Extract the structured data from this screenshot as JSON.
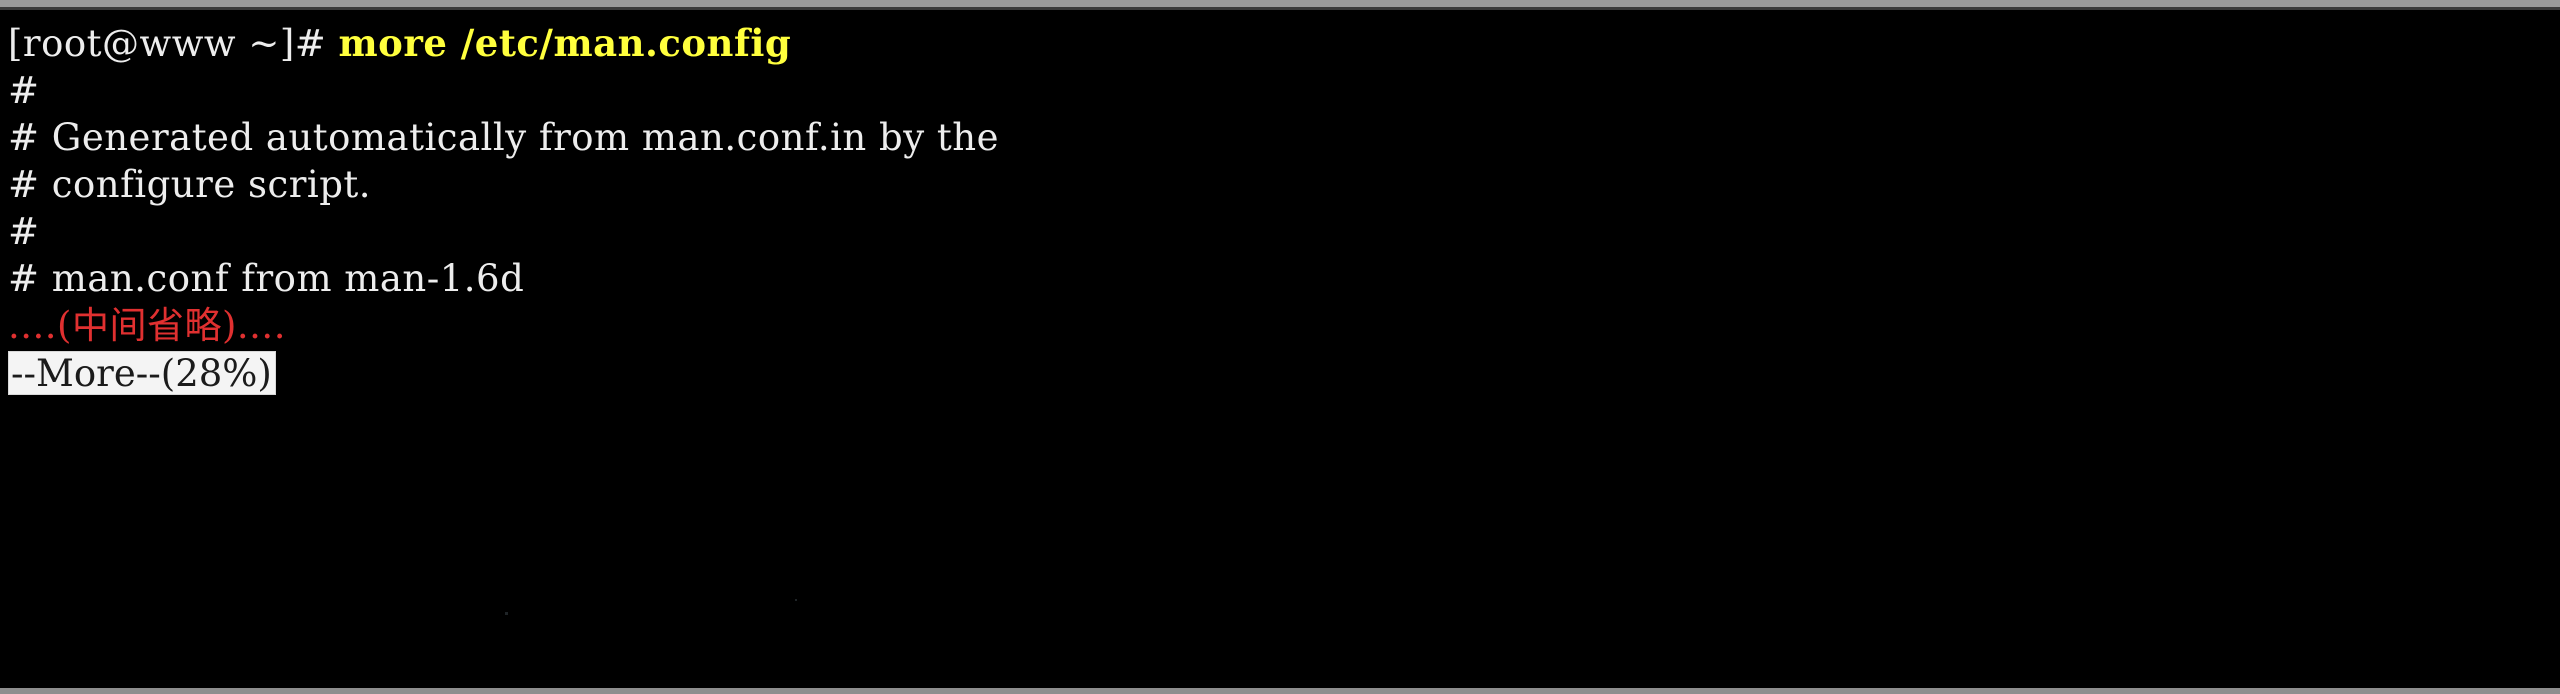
{
  "window": {
    "title": "more /etc/man.config",
    "background_color": "#000000",
    "frame_color": "#9a9a9a"
  },
  "colors": {
    "foreground": "#ededed",
    "command_yellow": "#ffff3d",
    "annotation_red": "#e03030",
    "status_background": "#f4f4f4",
    "status_foreground": "#1b1b1b"
  },
  "prompt": {
    "text": "[root@www ~]# ",
    "command": "more /etc/man.config"
  },
  "output_lines": [
    {
      "text": "#",
      "color": "white"
    },
    {
      "text": "# Generated automatically from man.conf.in by the",
      "color": "white"
    },
    {
      "text": "# configure script.",
      "color": "white"
    },
    {
      "text": "#",
      "color": "white"
    },
    {
      "text": "# man.conf from man-1.6d",
      "color": "white"
    },
    {
      "text": "....(中间省略)....",
      "color": "red"
    }
  ],
  "status": {
    "label": "--More--(28%)",
    "more_marker": "--More--",
    "percent": "28%"
  }
}
